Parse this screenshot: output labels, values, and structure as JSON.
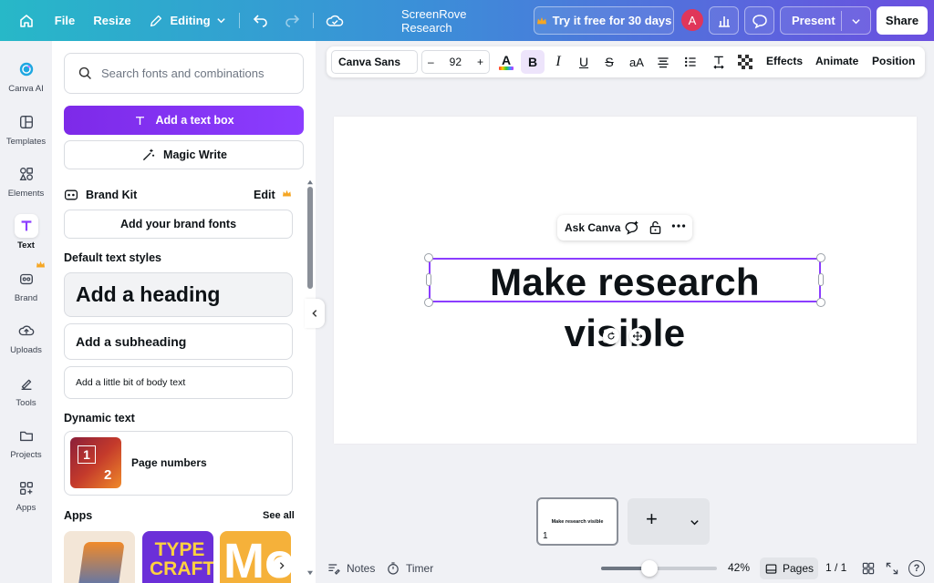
{
  "topbar": {
    "file_label": "File",
    "resize_label": "Resize",
    "editing_label": "Editing",
    "doc_title": "ScreenRove Research",
    "trial_label": "Try it free for 30 days",
    "avatar_initial": "A",
    "present_label": "Present",
    "share_label": "Share"
  },
  "rail": {
    "items": [
      {
        "label": "Canva AI",
        "icon": "canva-ai-icon"
      },
      {
        "label": "Templates",
        "icon": "templates-icon"
      },
      {
        "label": "Elements",
        "icon": "elements-icon"
      },
      {
        "label": "Text",
        "icon": "text-icon"
      },
      {
        "label": "Brand",
        "icon": "brand-icon"
      },
      {
        "label": "Uploads",
        "icon": "uploads-icon"
      },
      {
        "label": "Tools",
        "icon": "tools-icon"
      },
      {
        "label": "Projects",
        "icon": "projects-icon"
      },
      {
        "label": "Apps",
        "icon": "apps-icon"
      }
    ],
    "active": "Text"
  },
  "panel": {
    "search_placeholder": "Search fonts and combinations",
    "add_text_box": "Add a text box",
    "magic_write": "Magic Write",
    "brand_kit_title": "Brand Kit",
    "brand_kit_edit": "Edit",
    "add_brand_fonts": "Add your brand fonts",
    "default_styles_title": "Default text styles",
    "heading": "Add a heading",
    "subheading": "Add a subheading",
    "body": "Add a little bit of body text",
    "dynamic_title": "Dynamic text",
    "page_numbers": "Page numbers",
    "thumb_num_1": "1",
    "thumb_num_2": "2",
    "apps_title": "Apps",
    "see_all": "See all",
    "app_2_text": "TYPE CRAFT",
    "app_3_text": "Mo"
  },
  "toolbar": {
    "font": "Canva Sans",
    "size_minus": "–",
    "size": "92",
    "size_plus": "+",
    "bold": "B",
    "italic": "I",
    "underline": "U",
    "strike": "S",
    "case": "aA",
    "effects": "Effects",
    "animate": "Animate",
    "position": "Position"
  },
  "canvas": {
    "ask_canva": "Ask Canva",
    "heading_line1": "Make research",
    "heading_line2": "visible"
  },
  "pages": {
    "thumb_title": "Make research visible",
    "thumb_number": "1",
    "add_symbol": "+"
  },
  "bottombar": {
    "notes": "Notes",
    "timer": "Timer",
    "zoom": "42%",
    "zoom_level": 0.42,
    "pages_label": "Pages",
    "page_count": "1 / 1",
    "help": "?"
  },
  "colors": {
    "accent": "#8b3dff",
    "avatar": "#e0365a",
    "crown": "#f5a623"
  }
}
